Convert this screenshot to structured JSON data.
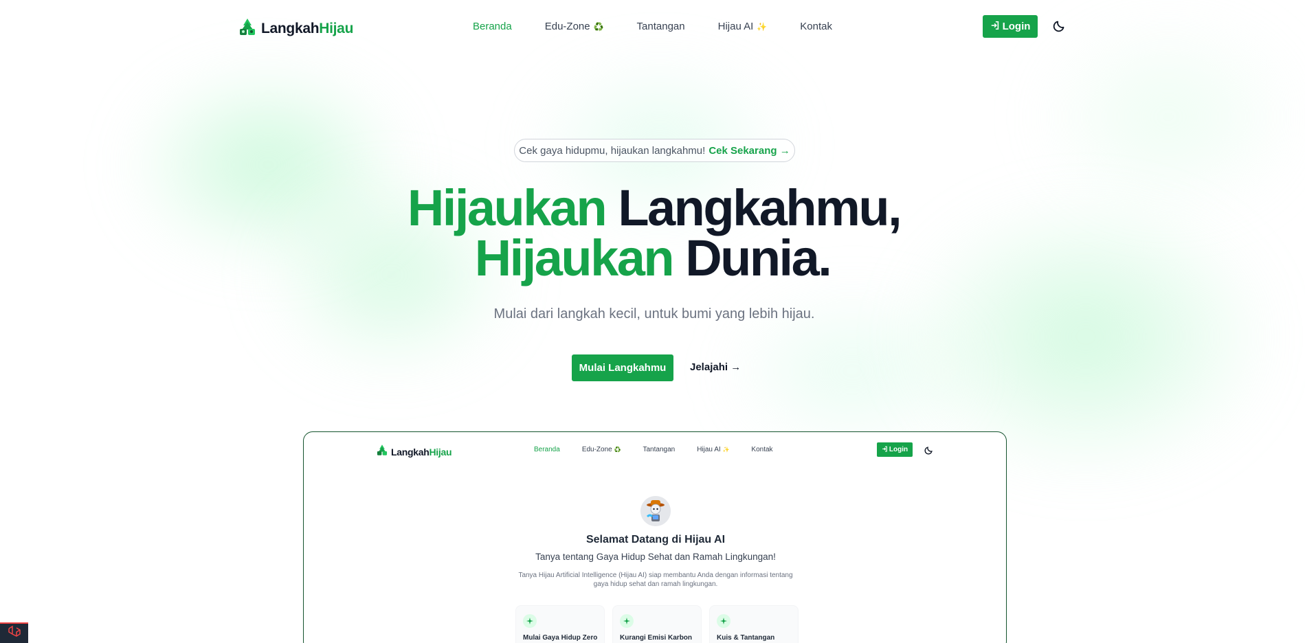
{
  "colors": {
    "accent": "#16a34a",
    "text": "#111827",
    "muted": "#6b7280"
  },
  "nav": {
    "brand_main": "Langkah",
    "brand_accent": "Hijau",
    "items": [
      {
        "label": "Beranda",
        "icon": ""
      },
      {
        "label": "Edu-Zone",
        "icon": "♻️"
      },
      {
        "label": "Tantangan",
        "icon": ""
      },
      {
        "label": "Hijau AI",
        "icon": "✨"
      },
      {
        "label": "Kontak",
        "icon": ""
      }
    ],
    "active_item": "Beranda",
    "login_label": "Login",
    "theme_icon": "moon-icon"
  },
  "hero": {
    "pill_text": "Cek gaya hidupmu, hijaukan langkahmu!",
    "pill_cta": "Cek Sekarang →",
    "headline_line1_green": "Hijaukan",
    "headline_line1_dark": "Langkahmu,",
    "headline_line2_green": "Hijaukan",
    "headline_line2_dark": "Dunia.",
    "subtitle": "Mulai dari langkah kecil, untuk bumi yang lebih hijau.",
    "primary_button": "Mulai Langkahmu",
    "secondary_button": "Jelajahi →"
  },
  "preview": {
    "nav": {
      "brand_main": "Langkah",
      "brand_accent": "Hijau",
      "items": [
        {
          "label": "Beranda",
          "icon": ""
        },
        {
          "label": "Edu-Zone",
          "icon": "♻️"
        },
        {
          "label": "Tantangan",
          "icon": ""
        },
        {
          "label": "Hijau AI",
          "icon": "✨"
        },
        {
          "label": "Kontak",
          "icon": ""
        }
      ],
      "login_label": "Login"
    },
    "title": "Selamat Datang di Hijau AI",
    "subtitle": "Tanya tentang Gaya Hidup Sehat dan Ramah Lingkungan!",
    "description": "Tanya Hijau Artificial Intelligence (Hijau AI) siap membantu Anda dengan informasi tentang gaya hidup sehat dan ramah lingkungan.",
    "cards": [
      {
        "label": "Mulai Gaya Hidup Zero"
      },
      {
        "label": "Kurangi Emisi Karbon"
      },
      {
        "label": "Kuis & Tantangan"
      }
    ]
  }
}
